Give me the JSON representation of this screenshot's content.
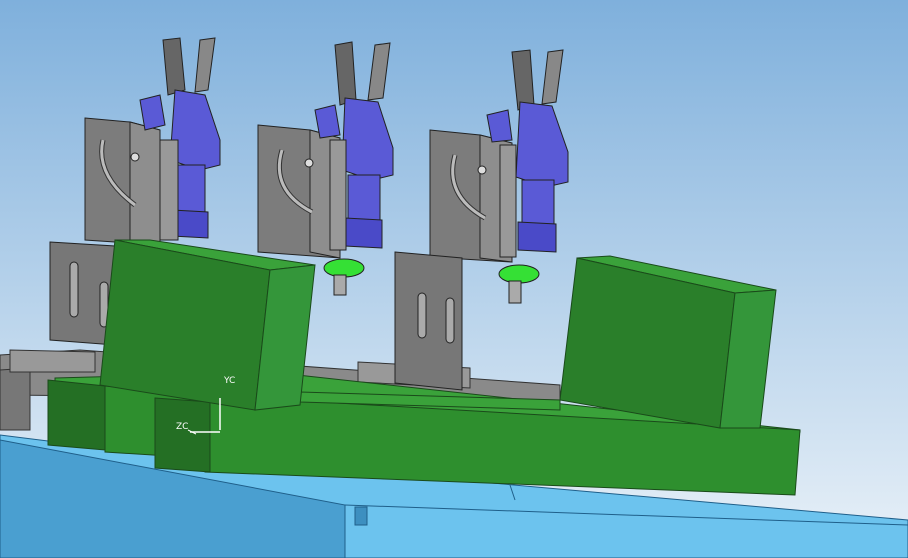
{
  "viewport": {
    "background_top": "#7fb0dc",
    "background_bottom": "#e9f1f8"
  },
  "colors": {
    "bracket_gray": "#7c7c7c",
    "bracket_dark": "#555555",
    "gripper_blue": "#5a5ad6",
    "gripper_blue_dark": "#3a3aa8",
    "ring_green": "#35e035",
    "block_green": "#2e8f2e",
    "block_green_dark": "#246f24",
    "block_green_light": "#3aa23a",
    "table_blue": "#4a9fd0",
    "table_blue_light": "#6cc3ee",
    "table_blue_dark": "#2f7fb1"
  },
  "icons": {
    "csys": "wcs-triad-icon"
  },
  "csys": {
    "y_label": "YC",
    "z_label": "ZC"
  }
}
